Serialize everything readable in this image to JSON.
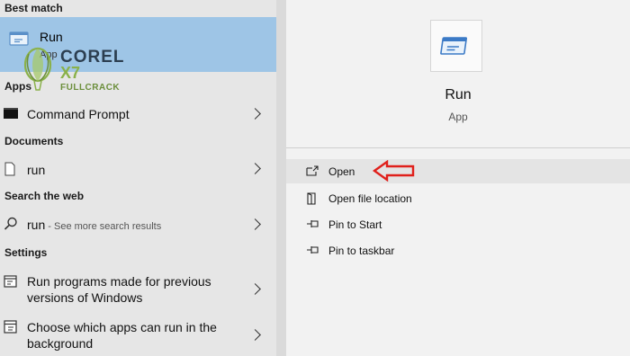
{
  "sections": {
    "best_match": "Best match",
    "apps": "Apps",
    "documents": "Documents",
    "search_web": "Search the web",
    "settings": "Settings"
  },
  "best_match": {
    "title": "Run",
    "subtitle": "App"
  },
  "apps": [
    {
      "label": "Command Prompt",
      "icon": "command-prompt-icon"
    }
  ],
  "documents": [
    {
      "label": "run",
      "icon": "document-icon"
    }
  ],
  "web": {
    "query": "run",
    "hint": " - See more search results",
    "icon": "search-icon"
  },
  "settings": [
    {
      "label_line1": "Run programs made for previous",
      "label_line2": "versions of Windows",
      "icon": "compatibility-icon"
    },
    {
      "label_line1": "Choose which apps can run in the",
      "label_line2": "background",
      "icon": "background-apps-icon"
    }
  ],
  "watermark": {
    "brand": "COREL",
    "version": "X7",
    "tag": "FULLCRACK"
  },
  "details": {
    "app_name": "Run",
    "app_type": "App",
    "actions": [
      {
        "label": "Open",
        "icon": "open-icon"
      },
      {
        "label": "Open file location",
        "icon": "file-location-icon"
      },
      {
        "label": "Pin to Start",
        "icon": "pin-icon"
      },
      {
        "label": "Pin to taskbar",
        "icon": "pin-icon"
      }
    ]
  },
  "colors": {
    "selection": "#9ec5e6",
    "annotation_arrow": "#e0201b"
  }
}
